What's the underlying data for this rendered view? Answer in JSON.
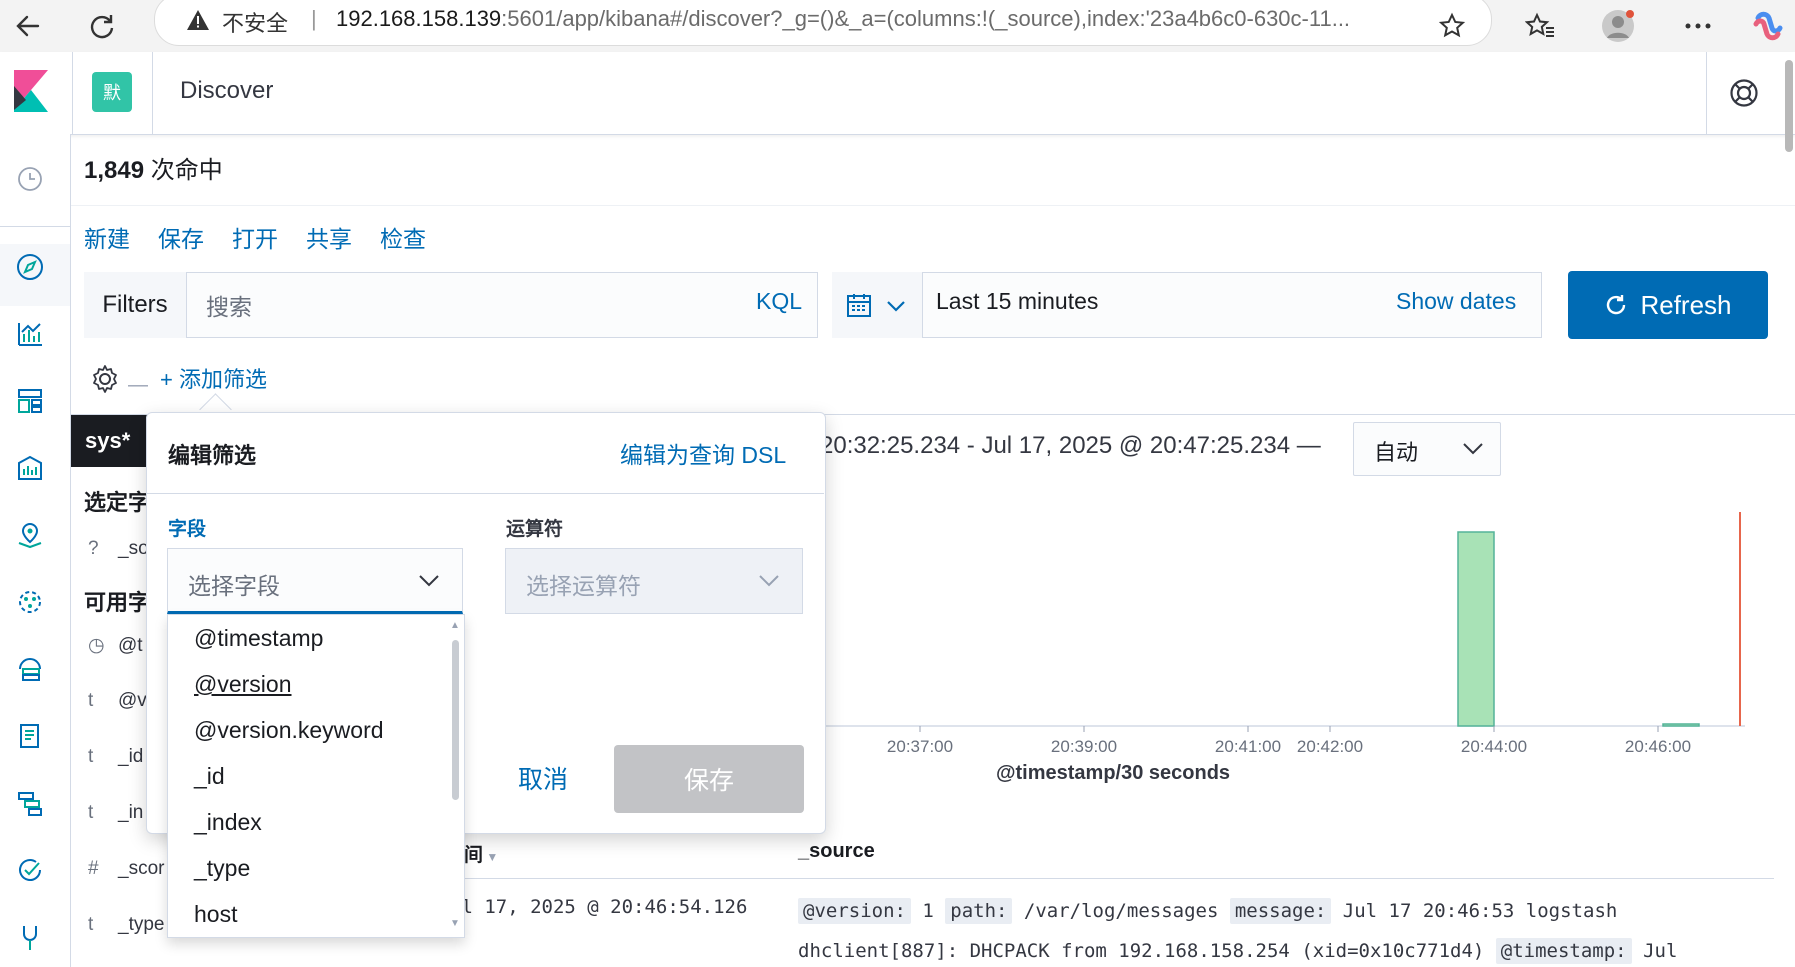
{
  "browser": {
    "insecure_label": "不安全",
    "url_host": "192.168.158.139",
    "url_rest": ":5601/app/kibana#/discover?_g=()&_a=(columns:!(_source),index:'23a4b6c0-630c-11..."
  },
  "header": {
    "space_initial": "默",
    "title": "Discover"
  },
  "hits": {
    "count": "1,849",
    "label": " 次命中"
  },
  "top_menu": {
    "new": "新建",
    "save": "保存",
    "open": "打开",
    "share": "共享",
    "inspect": "检查"
  },
  "query_bar": {
    "filters_label": "Filters",
    "search_placeholder": "搜索",
    "kql_label": "KQL"
  },
  "date_picker": {
    "range_label": "Last 15 minutes",
    "show_dates": "Show dates",
    "refresh_label": "Refresh"
  },
  "filter_row": {
    "add_filter": "+ 添加筛选"
  },
  "sidebar": {
    "index_pattern": "sys*",
    "selected_fields_title": "选定字",
    "available_fields_title": "可用字",
    "selected_fields": [
      {
        "type": "?",
        "name": "_so"
      }
    ],
    "available_fields": [
      {
        "type": "◷",
        "name": "@t"
      },
      {
        "type": "t",
        "name": "@v"
      },
      {
        "type": "t",
        "name": "_id"
      },
      {
        "type": "t",
        "name": "_in"
      },
      {
        "type": "#",
        "name": "_scor"
      },
      {
        "type": "t",
        "name": "_type"
      }
    ]
  },
  "histogram": {
    "time_range_text": "20:32:25.234 - Jul 17, 2025 @ 20:47:25.234 —",
    "interval": "自动",
    "x_ticks": [
      "20:37:00",
      "20:39:00",
      "20:41:00",
      "20:42:00",
      "20:44:00",
      "20:46:00"
    ],
    "x_label": "@timestamp/30 seconds"
  },
  "chart_data": {
    "type": "bar",
    "xlabel": "@timestamp/30 seconds",
    "ylabel": "",
    "categories": [
      "20:44:00",
      "20:46:30"
    ],
    "values": [
      1,
      0.01
    ],
    "tick_labels": [
      "20:37:00",
      "20:39:00",
      "20:41:00",
      "20:42:00",
      "20:44:00",
      "20:46:00"
    ]
  },
  "doc_table": {
    "time_header": "间",
    "source_header": "_source",
    "rows": [
      {
        "time": "ul 17, 2025 @ 20:46:54.126",
        "line1": [
          {
            "k": "@version:",
            "v": " 1 "
          },
          {
            "k": "path:",
            "v": " /var/log/messages "
          },
          {
            "k": "message:",
            "v": " Jul 17 20:46:53 logstash"
          }
        ],
        "line2_text": "dhclient[887]: DHCPACK from 192.168.158.254 (xid=0x10c771d4) ",
        "line2_key": "@timestamp:",
        "line2_tail": " Jul"
      }
    ]
  },
  "edit_filter": {
    "title": "编辑筛选",
    "edit_as_dsl": "编辑为查询 DSL",
    "field_label": "字段",
    "field_placeholder": "选择字段",
    "operator_label": "运算符",
    "operator_placeholder": "选择运算符",
    "cancel": "取消",
    "save": "保存",
    "field_options": [
      "@timestamp",
      "@version",
      "@version.keyword",
      "_id",
      "_index",
      "_type",
      "host"
    ]
  },
  "colors": {
    "accent": "#006bb4",
    "bar": "#a8e2b6",
    "bar_border": "#54b399",
    "marker": "#e7664c"
  }
}
